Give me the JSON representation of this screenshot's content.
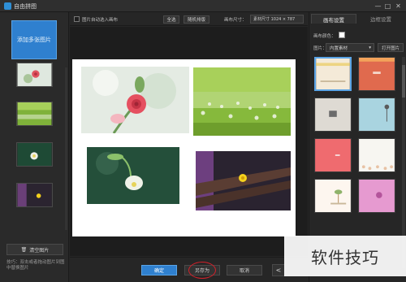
{
  "window": {
    "title": "自由拼图",
    "min": "—",
    "max": "□",
    "close": "✕"
  },
  "left": {
    "add_label": "添加多张图片",
    "clear_label": "清空图片",
    "tip": "技巧：双击或者拖动图片到图中替换图片"
  },
  "toolbar": {
    "auto_fill_label": "图片自动选入画布",
    "select_all": "全选",
    "random": "随机排版",
    "size_label": "画布尺寸：",
    "size_value": "素材尺寸 1024 × 787"
  },
  "right": {
    "tab_canvas": "画布设置",
    "tab_border": "边框设置",
    "bg_color_label": "画布颜色：",
    "bg_color": "#ffffff",
    "image_label": "图片：",
    "image_select": "内置素材",
    "open_button": "打开图片"
  },
  "bottom": {
    "ok": "确定",
    "save_as": "另存为",
    "cancel": "取消",
    "share_icon": "<"
  },
  "watermark": "软件技巧",
  "colors": {
    "accent": "#2f80cf",
    "highlight_circle": "#d4202a"
  }
}
